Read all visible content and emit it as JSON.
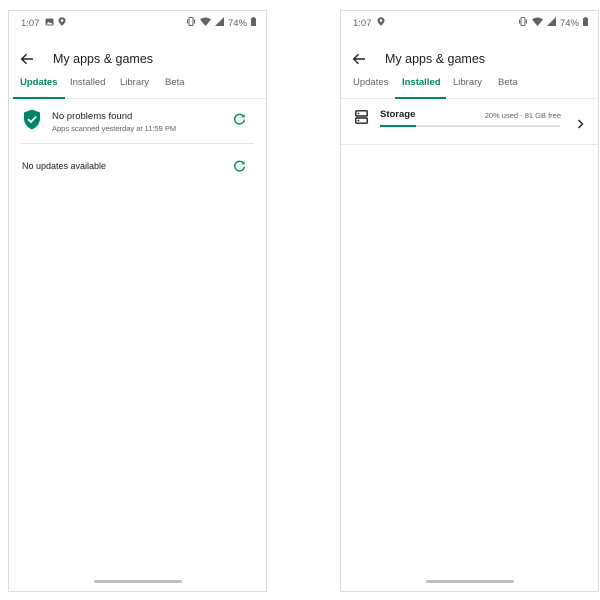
{
  "colors": {
    "accent": "#01875f",
    "text_primary": "#202124",
    "text_secondary": "#5f6368"
  },
  "left_phone": {
    "status": {
      "time": "1:07",
      "battery": "74%",
      "icons": [
        "image-icon",
        "location-icon",
        "vibrate-icon",
        "wifi-icon",
        "signal-icon",
        "battery-icon"
      ]
    },
    "title": "My apps & games",
    "tabs": [
      {
        "label": "Updates",
        "active": true
      },
      {
        "label": "Installed",
        "active": false
      },
      {
        "label": "Library",
        "active": false
      },
      {
        "label": "Beta",
        "active": false
      }
    ],
    "scan": {
      "title": "No problems found",
      "subtitle": "Apps scanned yesterday at 11:59 PM"
    },
    "updates_message": "No updates available"
  },
  "right_phone": {
    "status": {
      "time": "1:07",
      "battery": "74%",
      "icons": [
        "location-icon",
        "vibrate-icon",
        "wifi-icon",
        "signal-icon",
        "battery-icon"
      ]
    },
    "title": "My apps & games",
    "tabs": [
      {
        "label": "Updates",
        "active": false
      },
      {
        "label": "Installed",
        "active": true
      },
      {
        "label": "Library",
        "active": false
      },
      {
        "label": "Beta",
        "active": false
      }
    ],
    "storage": {
      "label": "Storage",
      "usage_text": "20% used - 81 GB free",
      "used_fraction": 0.2
    }
  }
}
